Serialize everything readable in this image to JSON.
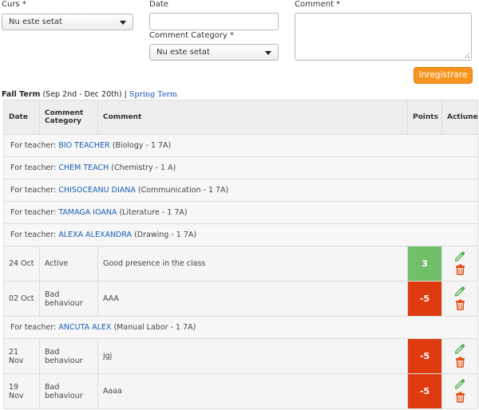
{
  "form": {
    "course_label": "Curs *",
    "course_value": "Nu este setat",
    "date_label": "Date",
    "date_value": "",
    "category_label": "Comment Category *",
    "category_value": "Nu este setat",
    "comment_label": "Comment *",
    "comment_value": "",
    "save_label": "Inregistrare"
  },
  "terms": {
    "active": "Fall Term",
    "active_range": "(Sep 2nd - Dec 20th)",
    "separator": "|",
    "other": "Spring Term"
  },
  "table": {
    "headers": {
      "date": "Date",
      "category": "Comment Category",
      "comment": "Comment",
      "points": "Points",
      "actions": "Actiune"
    },
    "teacher_prefix": "For teacher:",
    "rows": [
      {
        "type": "teacher",
        "name": "BIO TEACHER",
        "detail": "(Biology - 1 7A)"
      },
      {
        "type": "teacher",
        "name": "CHEM TEACH",
        "detail": "(Chemistry - 1 A)"
      },
      {
        "type": "teacher",
        "name": "CHISOCEANU DIANA",
        "detail": "(Communication - 1 7A)"
      },
      {
        "type": "teacher",
        "name": "TAMAGA IOANA",
        "detail": "(Literature - 1 7A)"
      },
      {
        "type": "teacher",
        "name": "ALEXA ALEXANDRA",
        "detail": "(Drawing - 1 7A)"
      },
      {
        "type": "entry",
        "date": "24 Oct",
        "category": "Active",
        "comment": "Good presence in the class",
        "points": "3",
        "sign": "pos"
      },
      {
        "type": "entry",
        "date": "02 Oct",
        "category": "Bad behaviour",
        "comment": "AAA",
        "points": "-5",
        "sign": "neg"
      },
      {
        "type": "teacher",
        "name": "ANCUTA ALEX",
        "detail": "(Manual Labor - 1 7A)"
      },
      {
        "type": "entry",
        "date": "21 Nov",
        "category": "Bad behaviour",
        "comment": "jgj",
        "points": "-5",
        "sign": "neg"
      },
      {
        "type": "entry",
        "date": "19 Nov",
        "category": "Bad behaviour",
        "comment": "Aaaa",
        "points": "-5",
        "sign": "neg"
      }
    ]
  },
  "colors": {
    "accent": "#f7941d",
    "positive": "#72bf6a",
    "negative": "#e03b10",
    "link": "#1a5fb4",
    "edit_icon": "#4caf50",
    "delete_icon": "#e24a12"
  },
  "icons": {
    "edit": "pencil-icon",
    "delete": "trash-icon",
    "dropdown": "chevron-down-icon",
    "resize": "resize-handle-icon"
  }
}
